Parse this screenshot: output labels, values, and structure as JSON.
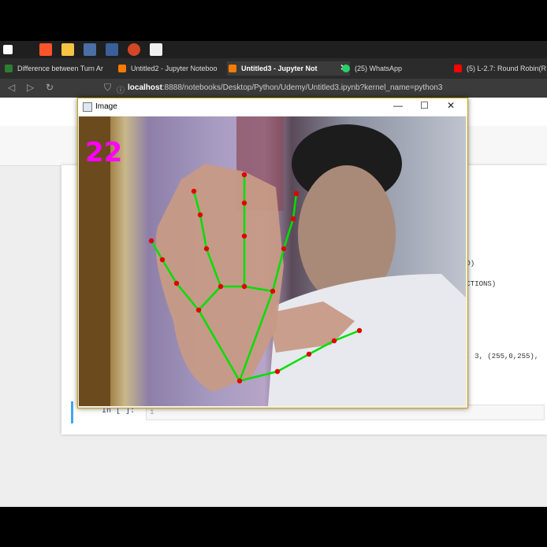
{
  "browser": {
    "tabs": [
      {
        "label": "Difference between Turn Ar",
        "icon_color": "#2e7d32",
        "active": false
      },
      {
        "label": "Untitled2 - Jupyter Noteboo",
        "icon_color": "#f57c00",
        "active": false
      },
      {
        "label": "Untitled3 - Jupyter Not",
        "icon_color": "#f57c00",
        "active": true
      },
      {
        "label": "(25) WhatsApp",
        "icon_color": "#25d366",
        "active": false
      },
      {
        "label": "(5) L-2.7: Round Robin(R",
        "icon_color": "#ff0000",
        "active": false
      }
    ],
    "url_host": "localhost",
    "url_rest": ":8888/notebooks/Desktop/Python/Udemy/Untitled3.ipynb?kernel_name=python3"
  },
  "notebook": {
    "code_fragments": [
      "ED)",
      "ECTIONS)",
      "N, 3, (255,0,255),"
    ],
    "cell_prompt": "In [ ]:",
    "cell_line_number": "1"
  },
  "image_window": {
    "title": "Image",
    "minimize": "—",
    "maximize": "☐",
    "close": "✕",
    "fps_text": "22"
  },
  "colors": {
    "landmark": "#e00000",
    "connection": "#00e000",
    "fps": "#ff00ff",
    "window_border": "#c9a400"
  },
  "icons": [
    "windows-start-icon",
    "brave-icon",
    "file-explorer-icon",
    "taskview-icon",
    "terminal-icon",
    "powerpoint-icon",
    "notepad-icon"
  ]
}
